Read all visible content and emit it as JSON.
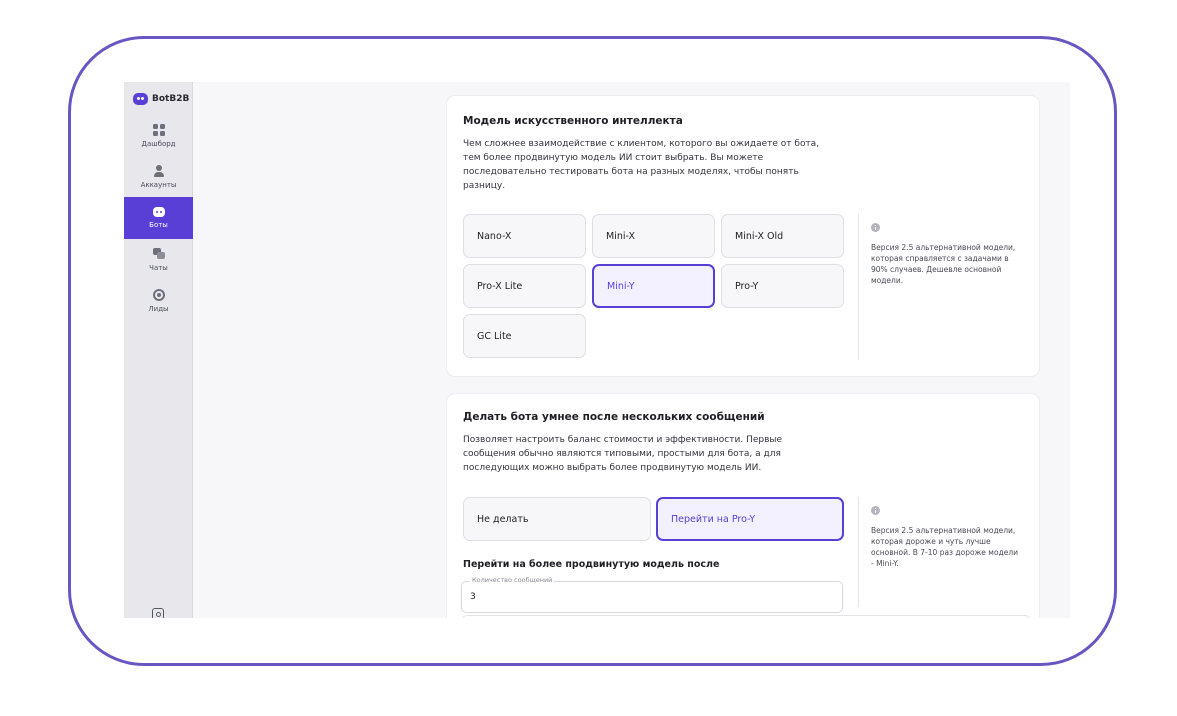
{
  "app": {
    "name": "BotB2B"
  },
  "sidebar": {
    "items": [
      {
        "label": "Дашборд",
        "icon": "dashboard-icon"
      },
      {
        "label": "Аккаунты",
        "icon": "user-icon"
      },
      {
        "label": "Боты",
        "icon": "bot-icon",
        "active": true
      },
      {
        "label": "Чаты",
        "icon": "chat-icon"
      },
      {
        "label": "Лиды",
        "icon": "target-icon"
      }
    ],
    "bottom_icon": "wallet-icon"
  },
  "model_section": {
    "title": "Модель искусственного интеллекта",
    "description": "Чем сложнее взаимодействие с клиентом, которого вы ожидаете от бота, тем более продвинутую модель ИИ стоит выбрать. Вы можете последовательно тестировать бота на разных моделях, чтобы понять разницу.",
    "options": [
      "Nano-X",
      "Mini-X",
      "Mini-X Old",
      "Pro-X Lite",
      "Mini-Y",
      "Pro-Y",
      "GC Lite"
    ],
    "selected": "Mini-Y",
    "info": "Версия 2.5 альтернативной модели, которая справляется с задачами в 90% случаев. Дешевле основной модели."
  },
  "upgrade_section": {
    "title": "Делать бота умнее после нескольких сообщений",
    "description": "Позволяет настроить баланс стоимости и эффективности. Первые сообщения обычно являются типовыми, простыми для бота, а для последующих можно выбрать более продвинутую модель ИИ.",
    "options": [
      "Не делать",
      "Перейти на Pro-Y"
    ],
    "selected": "Перейти на Pro-Y",
    "info": "Версия 2.5 альтернативной модели, которая дороже и чуть лучше основной. В 7-10 раз дороже модели - Mini-Y.",
    "switch_title": "Перейти на более продвинутую модель после",
    "message_count": {
      "label": "Количество сообщений",
      "value": "3"
    }
  },
  "colors": {
    "accent": "#5a3fd6",
    "frame": "#6a56c2",
    "sidebar_bg": "#e7e7ec"
  }
}
